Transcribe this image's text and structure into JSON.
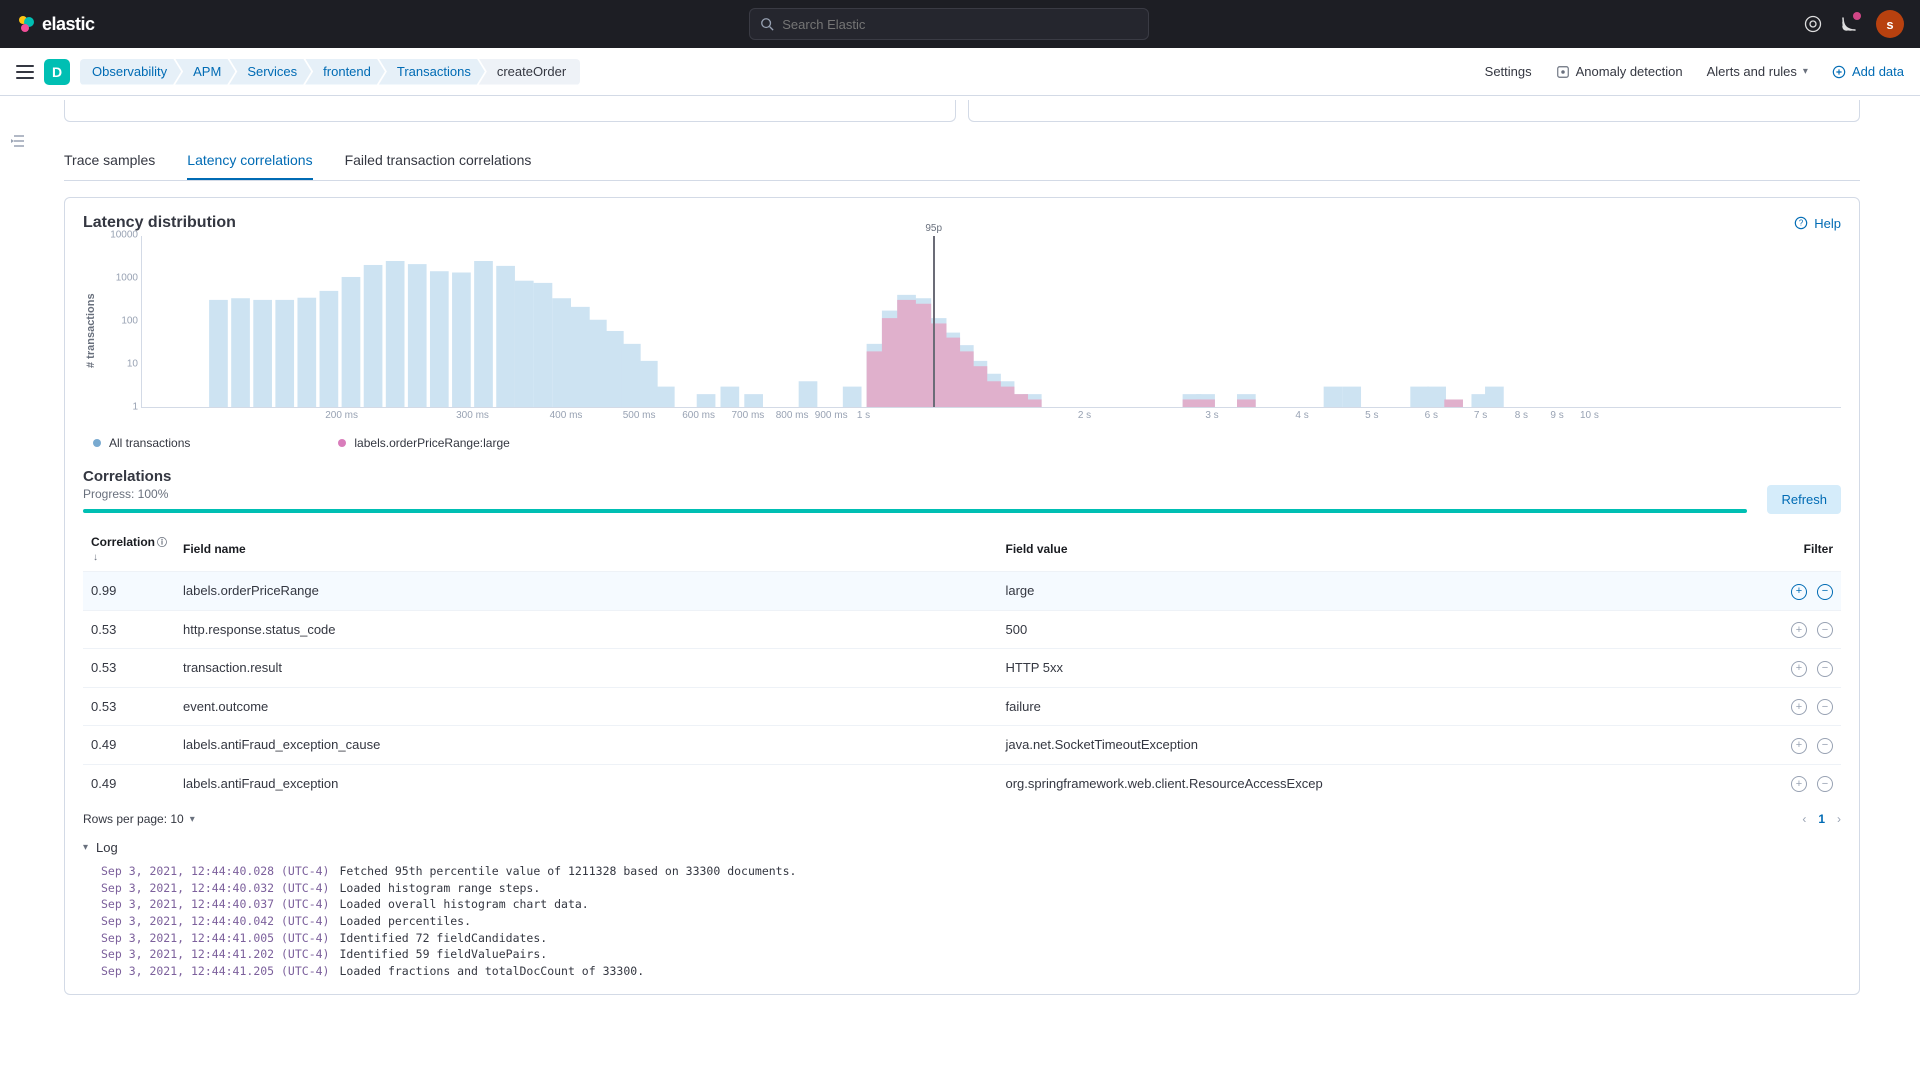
{
  "topbar": {
    "logo_text": "elastic",
    "search_placeholder": "Search Elastic",
    "avatar_initial": "s"
  },
  "subbar": {
    "space_letter": "D",
    "breadcrumbs": [
      "Observability",
      "APM",
      "Services",
      "frontend",
      "Transactions",
      "createOrder"
    ],
    "settings": "Settings",
    "anomaly": "Anomaly detection",
    "alerts": "Alerts and rules",
    "add_data": "Add data"
  },
  "tabs": {
    "trace_samples": "Trace samples",
    "latency_corr": "Latency correlations",
    "failed_corr": "Failed transaction correlations"
  },
  "panel": {
    "title": "Latency distribution",
    "help": "Help",
    "yaxis_label": "# transactions",
    "p95_label": "95p",
    "legend_all": "All transactions",
    "legend_sel": "labels.orderPriceRange:large"
  },
  "chart_data": {
    "type": "bar",
    "yscale": "log",
    "yticks": [
      "1",
      "10",
      "100",
      "1000",
      "10000"
    ],
    "xticks": [
      "200 ms",
      "300 ms",
      "400 ms",
      "500 ms",
      "600 ms",
      "700 ms",
      "800 ms",
      "900 ms",
      "1 s",
      "2 s",
      "3 s",
      "4 s",
      "5 s",
      "6 s",
      "7 s",
      "8 s",
      "9 s",
      "10 s"
    ],
    "xtick_rel": [
      0.118,
      0.195,
      0.25,
      0.293,
      0.328,
      0.357,
      0.383,
      0.406,
      0.425,
      0.555,
      0.63,
      0.683,
      0.724,
      0.759,
      0.788,
      0.812,
      0.833,
      0.852
    ],
    "p95_rel": 0.466,
    "series": [
      {
        "name": "All transactions",
        "color": "#cde3f2",
        "bars": [
          {
            "x": 0.045,
            "v": 320
          },
          {
            "x": 0.058,
            "v": 350
          },
          {
            "x": 0.071,
            "v": 320
          },
          {
            "x": 0.084,
            "v": 320
          },
          {
            "x": 0.097,
            "v": 360
          },
          {
            "x": 0.11,
            "v": 520
          },
          {
            "x": 0.123,
            "v": 1100
          },
          {
            "x": 0.136,
            "v": 2100
          },
          {
            "x": 0.149,
            "v": 2600
          },
          {
            "x": 0.162,
            "v": 2200
          },
          {
            "x": 0.175,
            "v": 1500
          },
          {
            "x": 0.188,
            "v": 1400
          },
          {
            "x": 0.201,
            "v": 2600
          },
          {
            "x": 0.214,
            "v": 2000
          },
          {
            "x": 0.225,
            "v": 900
          },
          {
            "x": 0.236,
            "v": 800
          },
          {
            "x": 0.247,
            "v": 350
          },
          {
            "x": 0.258,
            "v": 220
          },
          {
            "x": 0.268,
            "v": 110
          },
          {
            "x": 0.278,
            "v": 60
          },
          {
            "x": 0.288,
            "v": 30
          },
          {
            "x": 0.298,
            "v": 12
          },
          {
            "x": 0.308,
            "v": 3
          },
          {
            "x": 0.332,
            "v": 2
          },
          {
            "x": 0.346,
            "v": 3
          },
          {
            "x": 0.36,
            "v": 2
          },
          {
            "x": 0.392,
            "v": 4
          },
          {
            "x": 0.418,
            "v": 3
          },
          {
            "x": 0.432,
            "v": 30
          },
          {
            "x": 0.441,
            "v": 180
          },
          {
            "x": 0.45,
            "v": 420
          },
          {
            "x": 0.459,
            "v": 350
          },
          {
            "x": 0.468,
            "v": 120
          },
          {
            "x": 0.476,
            "v": 55
          },
          {
            "x": 0.484,
            "v": 28
          },
          {
            "x": 0.492,
            "v": 12
          },
          {
            "x": 0.5,
            "v": 6
          },
          {
            "x": 0.508,
            "v": 4
          },
          {
            "x": 0.516,
            "v": 2
          },
          {
            "x": 0.524,
            "v": 2
          },
          {
            "x": 0.618,
            "v": 2
          },
          {
            "x": 0.626,
            "v": 2
          },
          {
            "x": 0.65,
            "v": 2
          },
          {
            "x": 0.701,
            "v": 3
          },
          {
            "x": 0.712,
            "v": 3
          },
          {
            "x": 0.752,
            "v": 3
          },
          {
            "x": 0.762,
            "v": 3
          },
          {
            "x": 0.788,
            "v": 2
          },
          {
            "x": 0.796,
            "v": 3
          }
        ]
      },
      {
        "name": "labels.orderPriceRange:large",
        "color": "#e0b0cc",
        "bars": [
          {
            "x": 0.432,
            "v": 20
          },
          {
            "x": 0.441,
            "v": 120
          },
          {
            "x": 0.45,
            "v": 320
          },
          {
            "x": 0.459,
            "v": 260
          },
          {
            "x": 0.468,
            "v": 90
          },
          {
            "x": 0.476,
            "v": 42
          },
          {
            "x": 0.484,
            "v": 20
          },
          {
            "x": 0.492,
            "v": 9
          },
          {
            "x": 0.5,
            "v": 4
          },
          {
            "x": 0.508,
            "v": 3
          },
          {
            "x": 0.516,
            "v": 2
          },
          {
            "x": 0.524,
            "v": 1.5
          },
          {
            "x": 0.618,
            "v": 1.5
          },
          {
            "x": 0.626,
            "v": 1.5
          },
          {
            "x": 0.65,
            "v": 1.5
          },
          {
            "x": 0.772,
            "v": 1.5
          }
        ]
      }
    ]
  },
  "correlations": {
    "title": "Correlations",
    "progress_label": "Progress: 100%",
    "progress_pct": 100,
    "refresh": "Refresh",
    "cols": {
      "correlation": "Correlation",
      "field_name": "Field name",
      "field_value": "Field value",
      "filter": "Filter"
    },
    "rows": [
      {
        "corr": "0.99",
        "name": "labels.orderPriceRange",
        "value": "large",
        "selected": true
      },
      {
        "corr": "0.53",
        "name": "http.response.status_code",
        "value": "500"
      },
      {
        "corr": "0.53",
        "name": "transaction.result",
        "value": "HTTP 5xx"
      },
      {
        "corr": "0.53",
        "name": "event.outcome",
        "value": "failure"
      },
      {
        "corr": "0.49",
        "name": "labels.antiFraud_exception_cause",
        "value": "java.net.SocketTimeoutException"
      },
      {
        "corr": "0.49",
        "name": "labels.antiFraud_exception",
        "value": "org.springframework.web.client.ResourceAccessExcep"
      }
    ],
    "rows_per_page": "Rows per page: 10",
    "current_page": "1"
  },
  "log": {
    "title": "Log",
    "entries": [
      {
        "ts": "Sep 3, 2021, 12:44:40.028 (UTC-4)",
        "msg": "Fetched 95th percentile value of 1211328 based on 33300 documents."
      },
      {
        "ts": "Sep 3, 2021, 12:44:40.032 (UTC-4)",
        "msg": "Loaded histogram range steps."
      },
      {
        "ts": "Sep 3, 2021, 12:44:40.037 (UTC-4)",
        "msg": "Loaded overall histogram chart data."
      },
      {
        "ts": "Sep 3, 2021, 12:44:40.042 (UTC-4)",
        "msg": "Loaded percentiles."
      },
      {
        "ts": "Sep 3, 2021, 12:44:41.005 (UTC-4)",
        "msg": "Identified 72 fieldCandidates."
      },
      {
        "ts": "Sep 3, 2021, 12:44:41.202 (UTC-4)",
        "msg": "Identified 59 fieldValuePairs."
      },
      {
        "ts": "Sep 3, 2021, 12:44:41.205 (UTC-4)",
        "msg": "Loaded fractions and totalDocCount of 33300."
      }
    ]
  }
}
